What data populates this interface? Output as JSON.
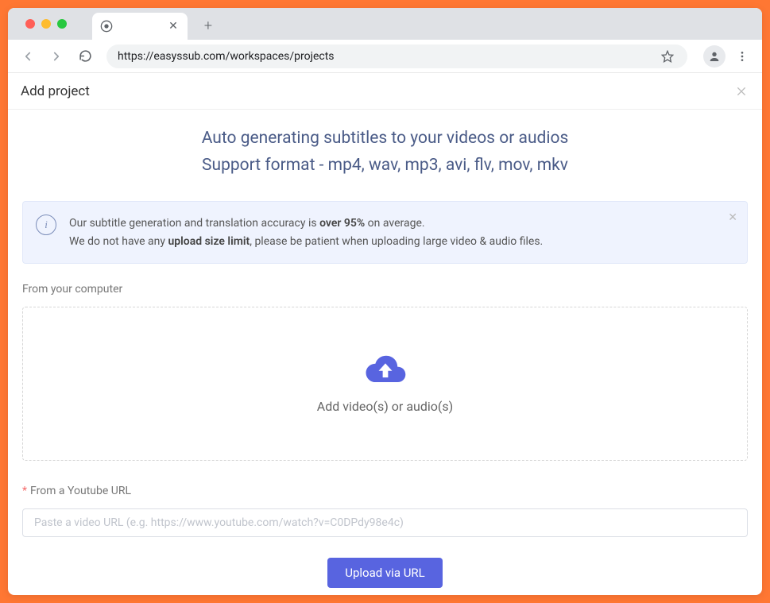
{
  "browser": {
    "url": "https://easyssub.com/workspaces/projects"
  },
  "header": {
    "title": "Add project"
  },
  "headline": {
    "line1": "Auto generating subtitles to your videos or audios",
    "line2": "Support format - mp4, wav, mp3, avi, flv, mov, mkv"
  },
  "info": {
    "pre1": "Our subtitle generation and translation accuracy is ",
    "bold1": "over 95%",
    "post1": " on average.",
    "pre2": "We do not have any ",
    "bold2": "upload size limit",
    "post2": ", please be patient when uploading large video & audio files."
  },
  "upload": {
    "computer_label": "From your computer",
    "dropzone_text": "Add video(s) or audio(s)",
    "youtube_label": "From a Youtube URL",
    "youtube_placeholder": "Paste a video URL (e.g. https://www.youtube.com/watch?v=C0DPdy98e4c)",
    "button_label": "Upload via URL"
  }
}
